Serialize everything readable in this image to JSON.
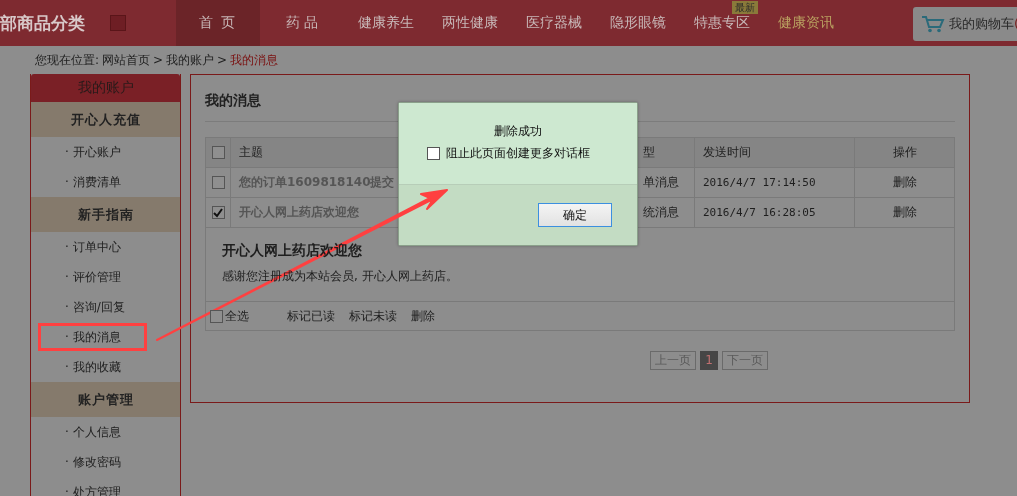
{
  "header": {
    "category_title": "部商品分类",
    "nav": [
      {
        "label": "首 页",
        "selected": true,
        "kind": "plain"
      },
      {
        "label": "药 品",
        "selected": false,
        "kind": "plain"
      },
      {
        "label": "健康养生",
        "selected": false,
        "kind": "plain"
      },
      {
        "label": "两性健康",
        "selected": false,
        "kind": "plain"
      },
      {
        "label": "医疗器械",
        "selected": false,
        "kind": "plain"
      },
      {
        "label": "隐形眼镜",
        "selected": false,
        "kind": "plain"
      },
      {
        "label": "特惠专区",
        "selected": false,
        "kind": "plain",
        "badge": "最新"
      },
      {
        "label": "健康资讯",
        "selected": false,
        "kind": "highlight"
      }
    ],
    "cart": {
      "label": "我的购物车",
      "count": "("
    }
  },
  "breadcrumb": [
    {
      "label": "您现在位置:",
      "kind": "prefix"
    },
    {
      "label": "网站首页",
      "kind": "link"
    },
    {
      "label": ">",
      "kind": "separator"
    },
    {
      "label": "我的账户",
      "kind": "link"
    },
    {
      "label": ">",
      "kind": "separator"
    },
    {
      "label": "我的消息",
      "kind": "current"
    }
  ],
  "sidebar": {
    "title": "我的账户",
    "sections": [
      {
        "title": "开心人充值",
        "items": [
          {
            "label": "· 开心账户",
            "annotated": false
          },
          {
            "label": "· 消费清单",
            "annotated": false
          }
        ]
      },
      {
        "title": "新手指南",
        "items": [
          {
            "label": "· 订单中心",
            "annotated": false
          },
          {
            "label": "· 评价管理",
            "annotated": false
          },
          {
            "label": "· 咨询/回复",
            "annotated": false
          },
          {
            "label": "· 我的消息",
            "annotated": true
          },
          {
            "label": "· 我的收藏",
            "annotated": false
          }
        ]
      },
      {
        "title": "账户管理",
        "items": [
          {
            "label": "· 个人信息",
            "annotated": false
          },
          {
            "label": "· 修改密码",
            "annotated": false
          },
          {
            "label": "· 处方管理",
            "annotated": false
          }
        ]
      }
    ]
  },
  "main": {
    "title": "我的消息",
    "table": {
      "header_checked": false,
      "columns": [
        "主题",
        "型",
        "发送时间",
        "操作"
      ],
      "rows": [
        {
          "checked": false,
          "subject": "您的订单1609818140提交",
          "type": "单消息",
          "time": "2016/4/7 17:14:50",
          "action": "删除"
        },
        {
          "checked": true,
          "subject": "开心人网上药店欢迎您",
          "type": "统消息",
          "time": "2016/4/7 16:28:05",
          "action": "删除"
        }
      ]
    },
    "detail": {
      "title": "开心人网上药店欢迎您",
      "body": "感谢您注册成为本站会员, 开心人网上药店。"
    },
    "footer": {
      "select_all": {
        "label": "全选",
        "checked": false
      },
      "actions": [
        "标记已读",
        "标记未读",
        "删除"
      ]
    },
    "pagination": {
      "prev": "上一页",
      "pages": [
        {
          "label": "1",
          "selected": true
        }
      ],
      "next": "下一页"
    }
  },
  "dialog": {
    "message": "删除成功",
    "suppress": {
      "label": "阻止此页面创建更多对话框",
      "checked": false
    },
    "ok": "确定"
  }
}
